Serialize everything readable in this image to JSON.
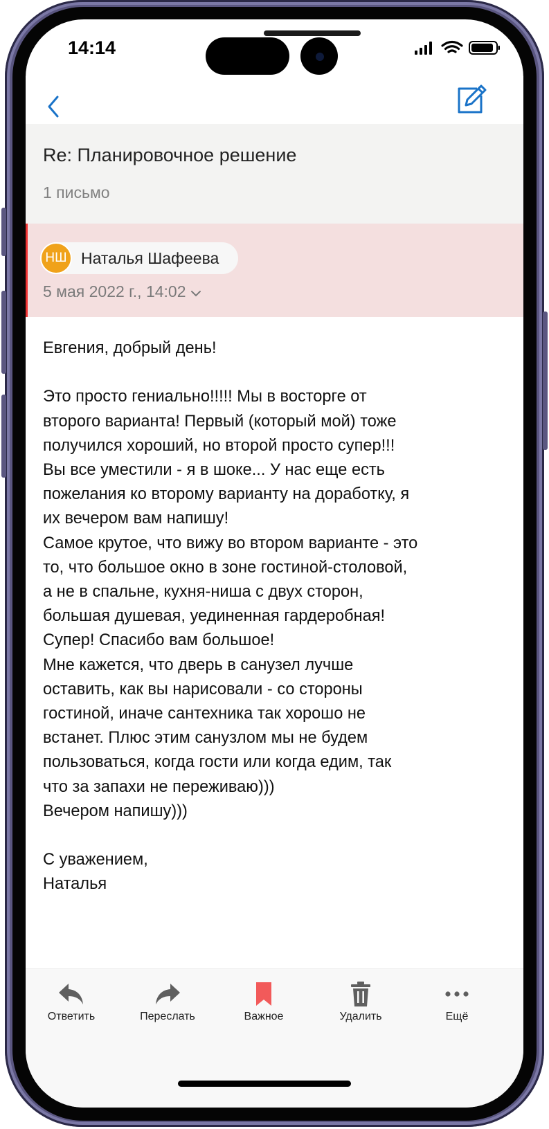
{
  "status": {
    "time": "14:14"
  },
  "thread": {
    "subject": "Re: Планировочное решение",
    "count": "1 письмо"
  },
  "sender": {
    "initials": "НШ",
    "name": "Наталья Шафеева",
    "date": "5 мая 2022 г., 14:02"
  },
  "message": {
    "paragraphs": [
      "Евгения, добрый день!",
      "Это просто гениально!!!!! Мы в восторге от\nвторого варианта! Первый (который мой) тоже\nполучился хороший, но второй просто супер!!!\nВы все уместили - я в шоке... У нас еще есть\nпожелания ко второму варианту на доработку, я\nих вечером вам напишу!\nСамое крутое, что вижу во втором варианте - это\nто, что большое окно в зоне гостиной-столовой,\nа не в спальне, кухня-ниша с двух сторон,\nбольшая душевая, уединенная гардеробная!\nСупер! Спасибо вам большое!\nМне кажется, что дверь в санузел лучше\nоставить, как вы нарисовали - со стороны\nгостиной, иначе сантехника так хорошо не\nвстанет. Плюс этим санузлом мы не будем\nпользоваться, когда гости или когда едим, так\nчто за запахи не переживаю)))\nВечером напишу)))",
      "С уважением,\nНаталья"
    ]
  },
  "toolbar": {
    "reply": "Ответить",
    "forward": "Переслать",
    "important": "Важное",
    "delete": "Удалить",
    "more": "Ещё"
  },
  "colors": {
    "accent": "#1a73c8",
    "sender_bg": "#f4dfdf",
    "avatar": "#f0a21a",
    "important": "#f25a5a"
  }
}
